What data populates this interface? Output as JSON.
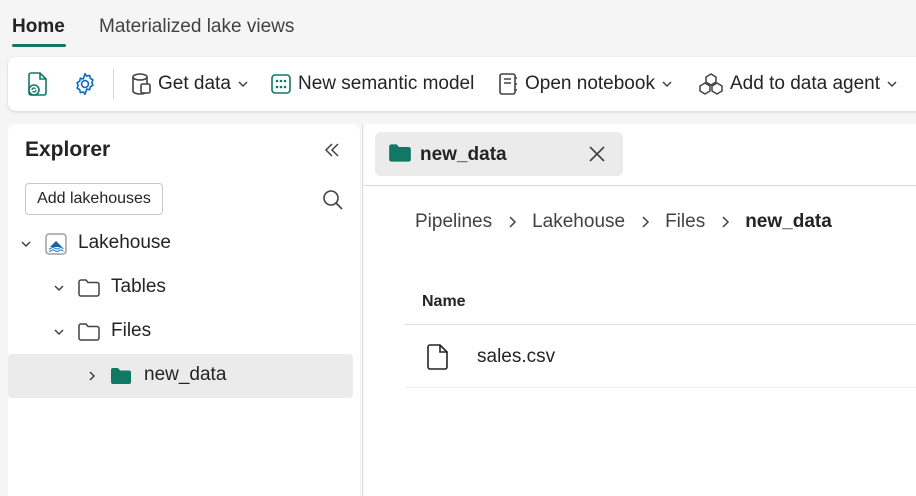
{
  "tabs": [
    {
      "label": "Home",
      "active": true
    },
    {
      "label": "Materialized lake views",
      "active": false
    }
  ],
  "toolbar": {
    "get_data": "Get data",
    "new_semantic_model": "New semantic model",
    "open_notebook": "Open notebook",
    "add_to_data_agent": "Add to data agent"
  },
  "explorer": {
    "title": "Explorer",
    "add_lakehouses": "Add lakehouses",
    "tree": {
      "root": "Lakehouse",
      "tables": "Tables",
      "files": "Files",
      "new_data": "new_data"
    }
  },
  "main": {
    "open_tab": "new_data",
    "breadcrumb": [
      "Pipelines",
      "Lakehouse",
      "Files",
      "new_data"
    ],
    "table": {
      "column_name": "Name",
      "rows": [
        {
          "name": "sales.csv"
        }
      ]
    }
  },
  "colors": {
    "accent": "#117865",
    "folder_fill": "#117865"
  }
}
